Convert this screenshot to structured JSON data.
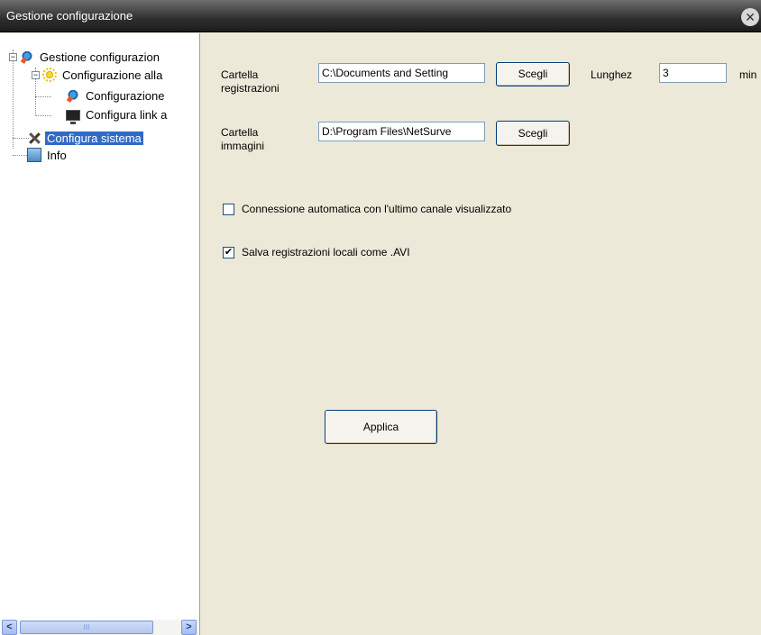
{
  "window": {
    "title": "Gestione configurazione",
    "close_symbol": "✕"
  },
  "tree": {
    "items": [
      {
        "label": "Gestione configurazion",
        "icon": "gear-icon",
        "expander": "−"
      },
      {
        "label": "Configurazione alla",
        "icon": "sun-icon",
        "expander": "−"
      },
      {
        "label": "Configurazione",
        "icon": "gear-icon"
      },
      {
        "label": "Configura link a",
        "icon": "monitor-icon"
      },
      {
        "label": "Configura sistema",
        "icon": "tools-icon",
        "selected": true
      },
      {
        "label": "Info",
        "icon": "info-icon"
      }
    ],
    "scroll_left": "<",
    "scroll_right": ">",
    "scroll_grip": "III"
  },
  "form": {
    "rec_folder_label_1": "Cartella",
    "rec_folder_label_2": "registrazioni",
    "rec_folder_value": "C:\\Documents and Setting",
    "img_folder_label_1": "Cartella",
    "img_folder_label_2": "immagini",
    "img_folder_value": "D:\\Program Files\\NetSurve",
    "choose_label": "Scegli",
    "length_label": "Lunghez",
    "length_value": "3",
    "length_unit": "min",
    "auto_connect_label": "Connessione automatica con l'ultimo canale visualizzato",
    "auto_connect_checked": false,
    "save_avi_label": "Salva registrazioni locali come .AVI",
    "save_avi_checked": true,
    "check_mark": "✔",
    "apply_label": "Applica"
  },
  "colors": {
    "selection": "#316ac5",
    "panel_bg": "#ece9d8",
    "titlebar": "#2e2e2e"
  }
}
